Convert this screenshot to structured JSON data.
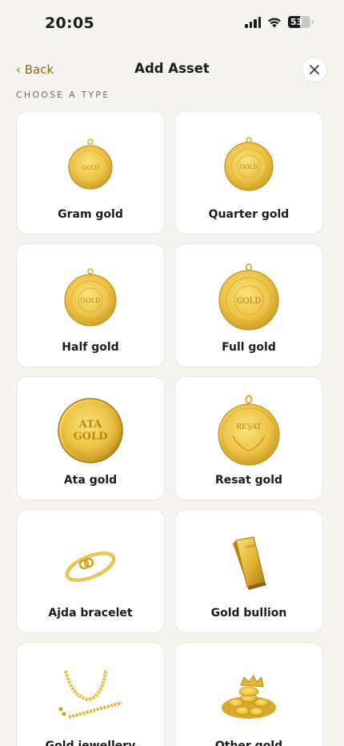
{
  "status_bar": {
    "time": "20:05",
    "battery_level": "53",
    "battery_fraction": 0.53
  },
  "header": {
    "back_label": "‹ Back",
    "title": "Add Asset",
    "close_icon": "close-icon"
  },
  "section_label": "CHOOSE A TYPE",
  "coin_text": "GOLD",
  "ata_text_1": "ATA",
  "ata_text_2": "GOLD",
  "resat_text": "REŞAT",
  "bullion_text": "GOLD",
  "asset_types": [
    {
      "label": "Gram gold",
      "icon": "gram-gold-coin-icon"
    },
    {
      "label": "Quarter gold",
      "icon": "quarter-gold-coin-icon"
    },
    {
      "label": "Half gold",
      "icon": "half-gold-coin-icon"
    },
    {
      "label": "Full gold",
      "icon": "full-gold-coin-icon"
    },
    {
      "label": "Ata gold",
      "icon": "ata-gold-coin-icon"
    },
    {
      "label": "Resat gold",
      "icon": "resat-gold-coin-icon"
    },
    {
      "label": "Ajda bracelet",
      "icon": "bracelet-icon"
    },
    {
      "label": "Gold bullion",
      "icon": "gold-bar-icon"
    },
    {
      "label": "Gold jewellery",
      "icon": "jewellery-icon"
    },
    {
      "label": "Other gold",
      "icon": "gold-pile-icon"
    }
  ],
  "colors": {
    "background": "#f6f4ef",
    "accent": "#8b6a1c",
    "gold": "#e8c04a"
  }
}
